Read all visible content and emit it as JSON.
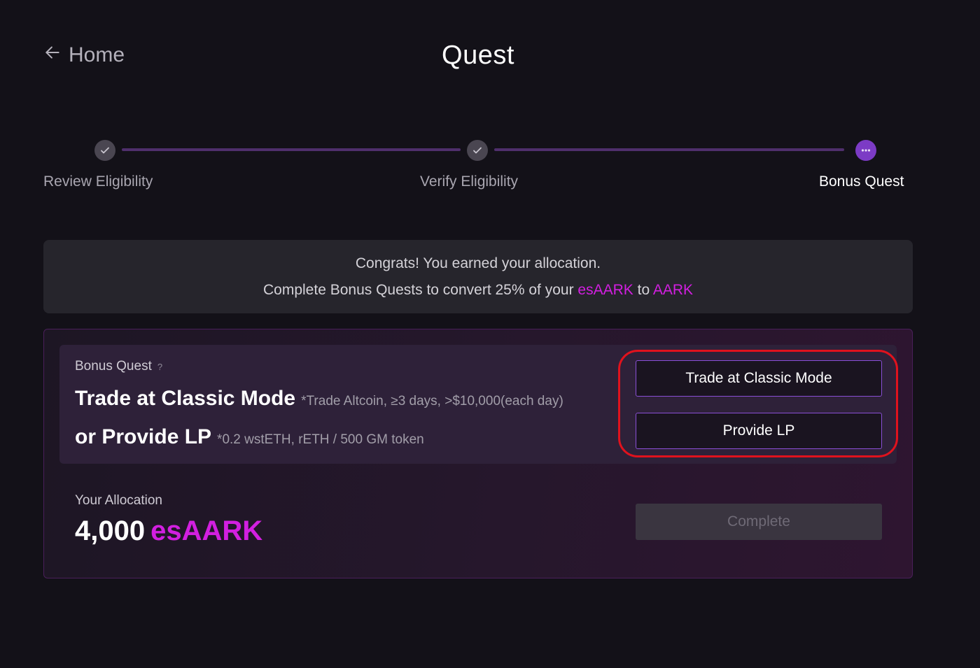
{
  "header": {
    "back_label": "Home",
    "title": "Quest"
  },
  "stepper": {
    "steps": [
      {
        "label": "Review Eligibility",
        "status": "done"
      },
      {
        "label": "Verify Eligibility",
        "status": "done"
      },
      {
        "label": "Bonus Quest",
        "status": "active"
      }
    ]
  },
  "banner": {
    "line1": "Congrats! You earned your allocation.",
    "line2_prefix": "Complete Bonus Quests to convert 25% of your ",
    "token1": "esAARK",
    "line2_middle": " to ",
    "token2": "AARK"
  },
  "quest": {
    "section_label": "Bonus Quest",
    "help_icon": "?",
    "option1_title": "Trade at Classic Mode",
    "option1_note": "*Trade Altcoin, ≥3 days, >$10,000(each day)",
    "option2_title": "or Provide LP",
    "option2_note": "*0.2 wstETH, rETH / 500 GM token",
    "button1_label": "Trade at Classic Mode",
    "button2_label": "Provide LP"
  },
  "allocation": {
    "label": "Your Allocation",
    "amount": "4,000",
    "token": "esAARK",
    "complete_label": "Complete"
  },
  "colors": {
    "background": "#131118",
    "accent": "#d21fe0",
    "highlight": "#e0121d",
    "button_border": "#8a4fd6"
  }
}
